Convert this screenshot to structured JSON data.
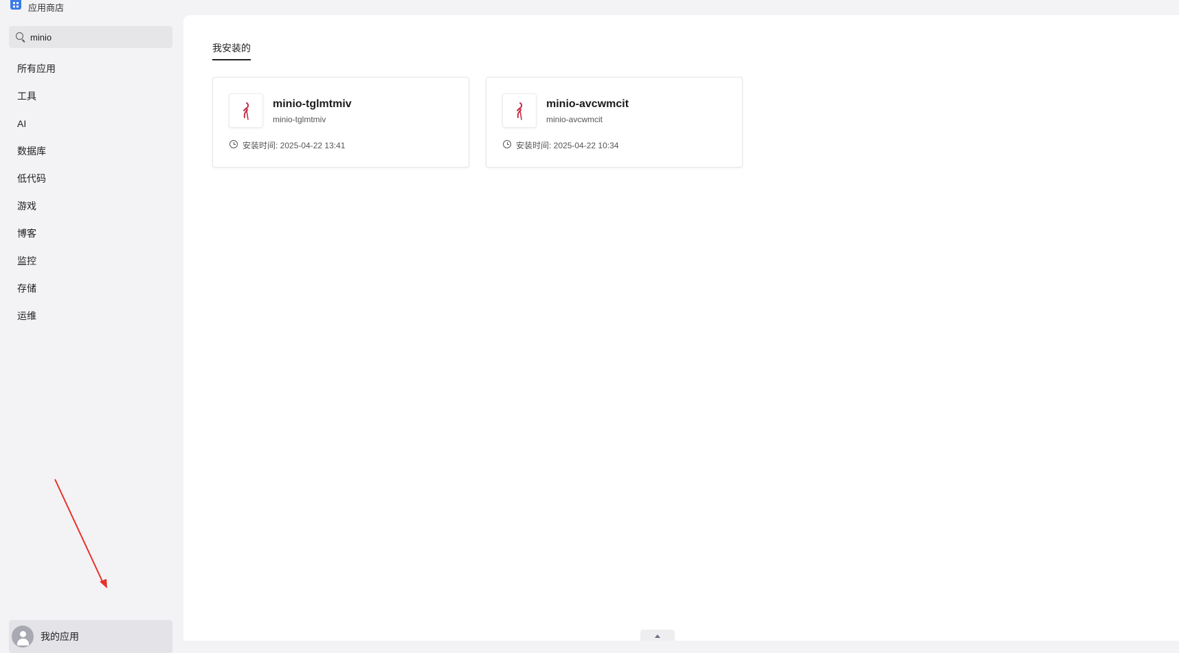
{
  "window": {
    "title": "应用商店",
    "icon": "app-store-icon"
  },
  "search": {
    "value": "minio",
    "icon": "search-icon"
  },
  "sidebar": {
    "categories": [
      {
        "label": "所有应用"
      },
      {
        "label": "工具"
      },
      {
        "label": "AI"
      },
      {
        "label": "数据库"
      },
      {
        "label": "低代码"
      },
      {
        "label": "游戏"
      },
      {
        "label": "博客"
      },
      {
        "label": "监控"
      },
      {
        "label": "存储"
      },
      {
        "label": "运维"
      }
    ],
    "my_apps": {
      "label": "我的应用",
      "icon": "user-avatar-icon"
    }
  },
  "main": {
    "tab": "我安装的",
    "apps": [
      {
        "title": "minio-tglmtmiv",
        "subtitle": "minio-tglmtmiv",
        "install_label": "安装时间: ",
        "install_time": "2025-04-22 13:41",
        "logo": "minio-flamingo-logo"
      },
      {
        "title": "minio-avcwmcit",
        "subtitle": "minio-avcwmcit",
        "install_label": "安装时间: ",
        "install_time": "2025-04-22 10:34",
        "logo": "minio-flamingo-logo"
      }
    ]
  },
  "colors": {
    "accent": "#3b7bea",
    "minio_logo": "#c72c48",
    "annotation_arrow": "#e8302a"
  }
}
